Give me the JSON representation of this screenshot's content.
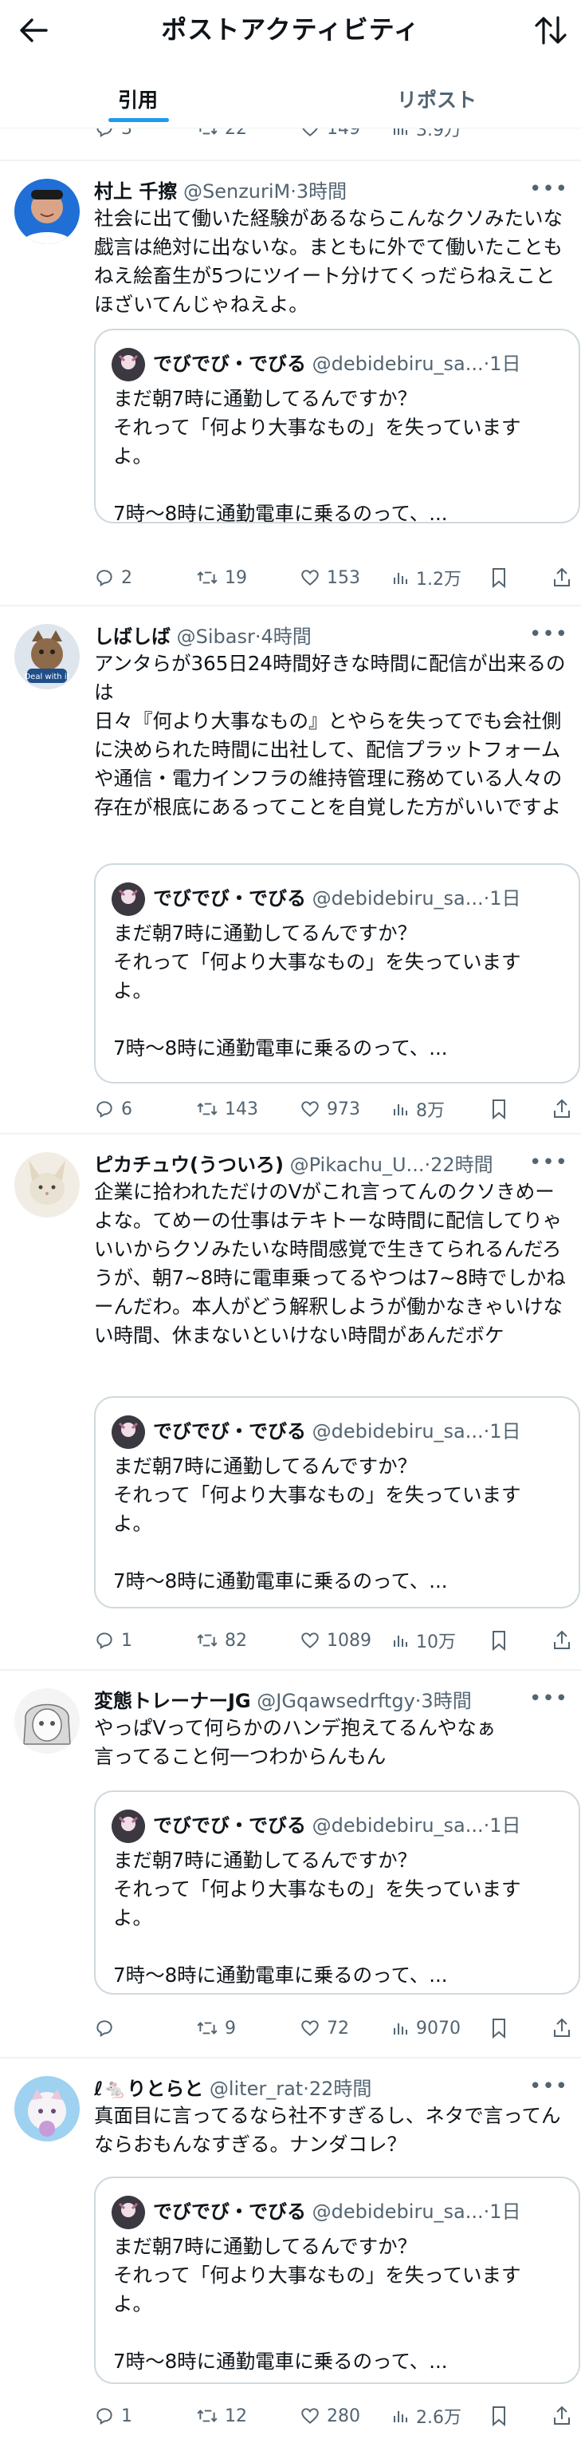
{
  "header": {
    "title": "ポストアクティビティ"
  },
  "tabs": [
    {
      "label": "引用"
    },
    {
      "label": "リポスト"
    }
  ],
  "quoted": {
    "name": "でびでび・でびる",
    "handle": "@debidebiru_sa...",
    "time": "1日",
    "text": "まだ朝7時に通勤してるんですか？\nそれって「何より大事なもの」を失っています\nよ。\n\n7時〜8時に通勤電車に乗るのって、..."
  },
  "partial_row": {
    "retweets": "22",
    "likes": "149",
    "views": "3.9万"
  },
  "posts": [
    {
      "name": "村上 千擦",
      "handle": "@SenzuriM",
      "time": "3時間",
      "text": "社会に出て働いた経験があるならこんなクソみたいな戯言は絶対に出ないな。まともに外でて働いたこともねえ絵畜生が5つにツイート分けてくっだらねえことほざいてんじゃねえよ。",
      "replies": "2",
      "retweets": "19",
      "likes": "153",
      "views": "1.2万"
    },
    {
      "name": "しばしば",
      "handle": "@Sibasr",
      "time": "4時間",
      "text": "アンタらが365日24時間好きな時間に配信が出来るのは\n日々『何より大事なもの』とやらを失ってでも会社側に決められた時間に出社して、配信プラットフォームや通信・電力インフラの維持管理に務めている人々の存在が根底にあるってことを自覚した方がいいですよ",
      "replies": "6",
      "retweets": "143",
      "likes": "973",
      "views": "8万"
    },
    {
      "name": "ピカチュウ(うついろ)",
      "handle": "@Pikachu_U...",
      "time": "22時間",
      "text": "企業に拾われただけのVがこれ言ってんのクソきめーよな。てめーの仕事はテキトーな時間に配信してりゃいいからクソみたいな時間感覚で生きてられるんだろうが、朝7~8時に電車乗ってるやつは7~8時でしかねーんだわ。本人がどう解釈しようが働かなきゃいけない時間、休まないといけない時間があんだボケ",
      "replies": "1",
      "retweets": "82",
      "likes": "1089",
      "views": "10万"
    },
    {
      "name": "変態トレーナーJG",
      "handle": "@JGqawsedrftgy",
      "time": "3時間",
      "text": "やっぱVって何らかのハンデ抱えてるんやなぁ\n言ってること何一つわからんもん",
      "replies": "",
      "retweets": "9",
      "likes": "72",
      "views": "9070"
    },
    {
      "name": "ℓ🐁りとらと",
      "handle": "@liter_rat",
      "time": "22時間",
      "text": "真面目に言ってるなら社不すぎるし、ネタで言ってんならおもんなすぎる。ナンダコレ？",
      "replies": "1",
      "retweets": "12",
      "likes": "280",
      "views": "2.6万"
    }
  ]
}
